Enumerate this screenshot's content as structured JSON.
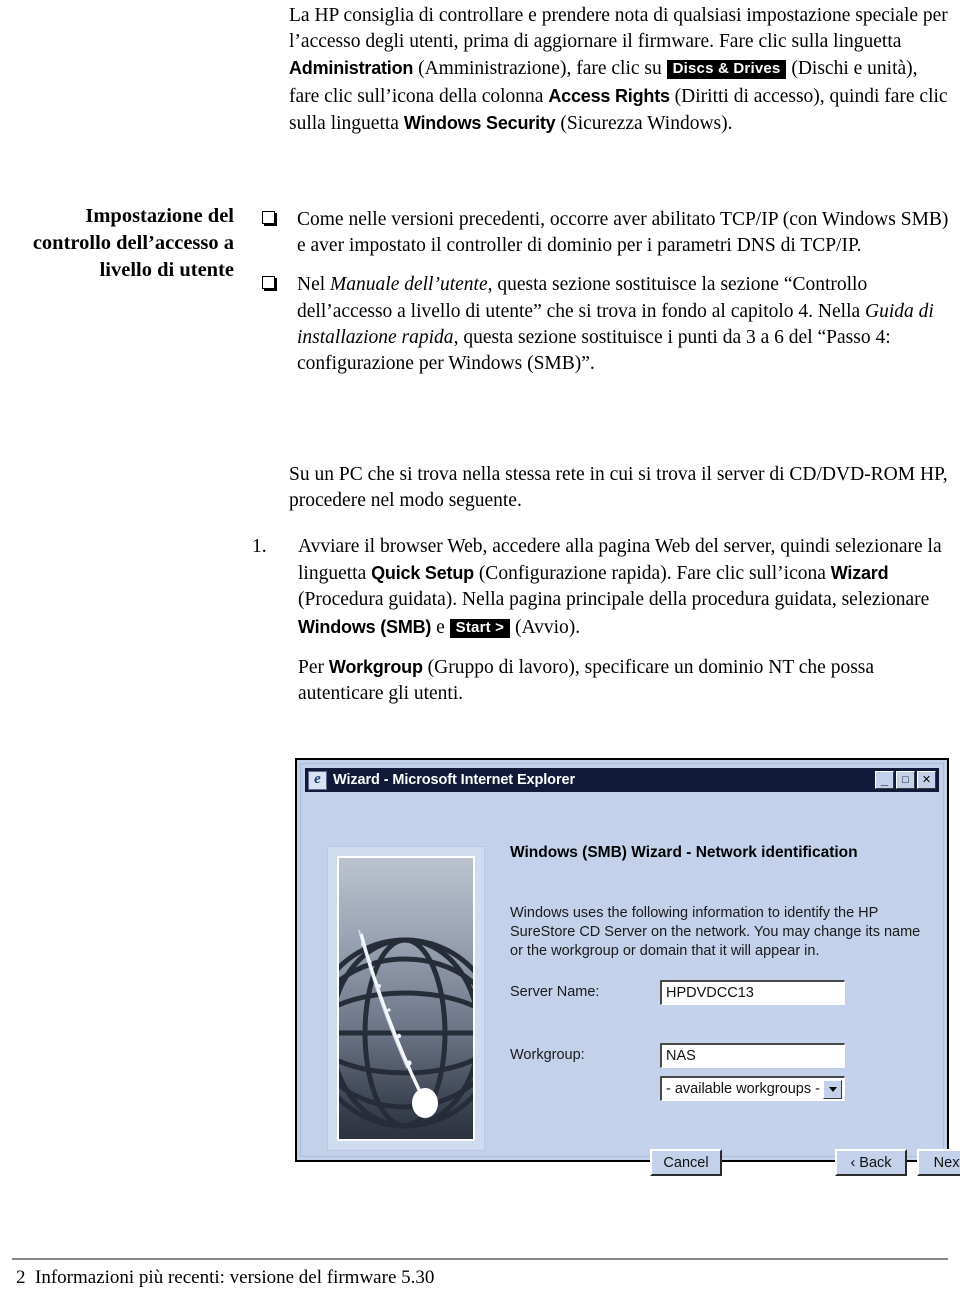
{
  "margin_heading": "Impostazione del controllo dell’accesso a livello di utente",
  "intro": {
    "p1_a": "La HP consiglia di controllare e prendere nota di qualsiasi impostazione speciale per l’accesso degli utenti, prima di aggiornare il firmware. ",
    "p1_b": "Fare clic sulla linguetta ",
    "tab_administration": "Administration",
    "p1_c": " (Amministrazione), fare clic su ",
    "badge_discs_drives": "Discs & Drives",
    "p1_d": " (Dischi e unità), fare clic sull’icona della colonna ",
    "col_access_rights": "Access Rights",
    "p1_e": " (Diritti di accesso), quindi fare clic sulla linguetta ",
    "tab_windows_security": "Windows Security",
    "p1_f": " (Sicurezza Windows)."
  },
  "bullets": [
    {
      "text_a": "Come nelle versioni precedenti, occorre aver abilitato TCP/IP (con Windows SMB) e aver impostato il controller di dominio per i parametri DNS di TCP/IP."
    },
    {
      "text_a": "Nel ",
      "ital_1": "Manuale dell’utente",
      "text_b": ", questa sezione sostituisce la sezione “Controllo dell’accesso a livello di utente” che si trova in fondo al capitolo 4. Nella ",
      "ital_2": "Guida di installazione rapida",
      "text_c": ", questa sezione sostituisce i punti da 3 a 6 del “Passo 4: configurazione per Windows (SMB)”."
    }
  ],
  "intro_para": "Su un PC che si trova nella stessa rete in cui si trova il server di CD/DVD-ROM HP, procedere nel modo seguente.",
  "numbered": {
    "marker": "1.",
    "text_a": "Avviare il browser Web, accedere alla pagina Web del server, quindi selezionare la linguetta ",
    "tab_quick_setup": "Quick Setup",
    "text_b": " (Configurazione rapida). Fare clic sull’icona ",
    "icon_wizard": "Wizard",
    "text_c": " (Procedura guidata). Nella pagina principale della procedura guidata, selezionare ",
    "opt_windows_smb": "Windows (SMB)",
    "text_d": " e ",
    "badge_start": "Start >",
    "text_e": " (Avvio).",
    "sub_a": "Per ",
    "sub_bold": "Workgroup",
    "sub_b": " (Gruppo di lavoro), specificare un dominio NT che possa autenticare gli utenti."
  },
  "screenshot": {
    "window_title": "Wizard - Microsoft Internet Explorer",
    "icon_name": "internet-explorer-icon",
    "window_buttons": {
      "minimize": "_",
      "maximize": "□",
      "close": "✕"
    },
    "heading": "Windows (SMB) Wizard  -  Network identification",
    "description": "Windows uses the following information to identify the HP SureStore CD Server on the network. You may change its name or the workgroup or domain that it will appear in.",
    "fields": [
      {
        "label": "Server Name:",
        "value": "HPDVDCC13"
      },
      {
        "label": "Workgroup:",
        "value": "NAS"
      }
    ],
    "combo": {
      "value": "- available workgroups -"
    },
    "buttons": {
      "cancel": "Cancel",
      "back": "‹ Back",
      "next": "Next ›"
    },
    "colors": {
      "dialog_face": "#c3d2ea",
      "titlebar": "#121a3a",
      "field_bg": "#ffffff"
    }
  },
  "footer": {
    "page_number": "2",
    "text": "Informazioni più recenti: versione del firmware 5.30"
  }
}
